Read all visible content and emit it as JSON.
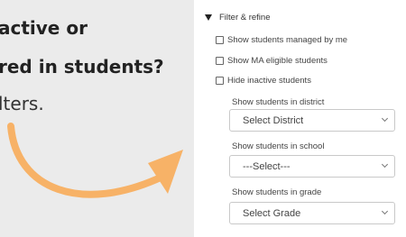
{
  "left_text": {
    "line1": "active or",
    "line2": "red in students?",
    "line3": "lters."
  },
  "colors": {
    "arrow": "#f7b267",
    "panel_bg": "#ffffff",
    "page_bg": "#ebebeb"
  },
  "filter": {
    "header_label": "Filter & refine",
    "header_icon": "triangle-down-icon",
    "checkboxes": [
      {
        "label": "Show students managed by me",
        "checked": false
      },
      {
        "label": "Show MA eligible students",
        "checked": false
      },
      {
        "label": "Hide inactive students",
        "checked": false
      }
    ],
    "district": {
      "label": "Show students in district",
      "value": "Select District"
    },
    "school": {
      "label": "Show students in school",
      "value": "---Select---"
    },
    "grade": {
      "label": "Show students in grade",
      "value": "Select Grade"
    }
  }
}
